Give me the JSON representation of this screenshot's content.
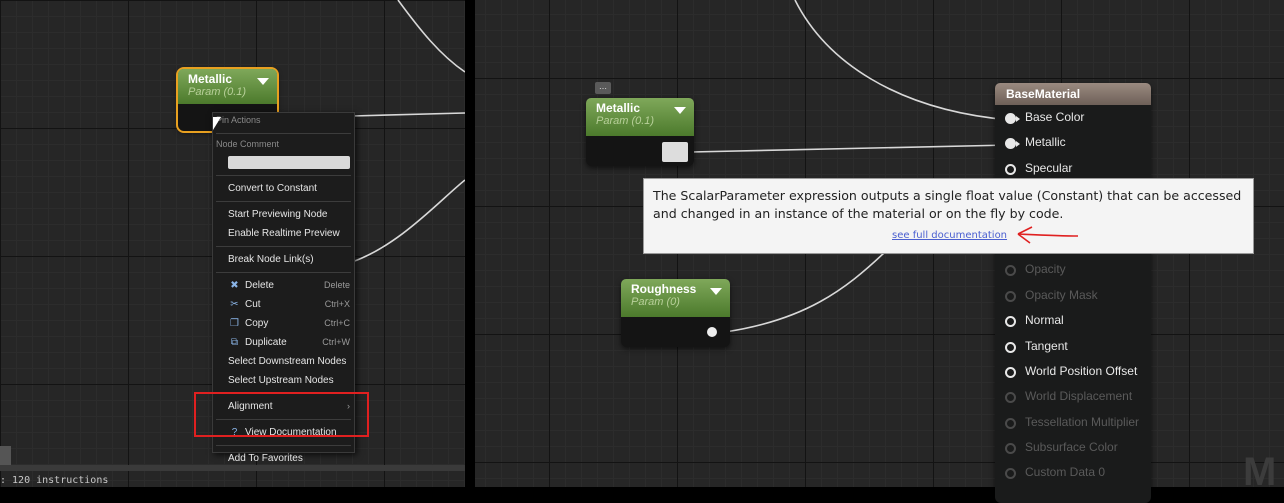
{
  "left_panel": {
    "metallic_node": {
      "title": "Metallic",
      "subtitle": "Param (0.1)"
    },
    "context_menu": {
      "pin_actions_header": "Pin Actions",
      "node_comment_header": "Node Comment",
      "items": [
        {
          "label": "Convert to Constant",
          "shortcut": "",
          "icon": ""
        },
        {
          "label": "Start Previewing Node",
          "shortcut": "",
          "icon": ""
        },
        {
          "label": "Enable Realtime Preview",
          "shortcut": "",
          "icon": ""
        },
        {
          "label": "Break Node Link(s)",
          "shortcut": "",
          "icon": ""
        },
        {
          "label": "Delete",
          "shortcut": "Delete",
          "icon": "delete-icon"
        },
        {
          "label": "Cut",
          "shortcut": "Ctrl+X",
          "icon": "cut-icon"
        },
        {
          "label": "Copy",
          "shortcut": "Ctrl+C",
          "icon": "copy-icon"
        },
        {
          "label": "Duplicate",
          "shortcut": "Ctrl+W",
          "icon": "duplicate-icon"
        },
        {
          "label": "Select Downstream Nodes",
          "shortcut": "",
          "icon": ""
        },
        {
          "label": "Select Upstream Nodes",
          "shortcut": "",
          "icon": ""
        },
        {
          "label": "Alignment",
          "shortcut": "",
          "icon": ""
        },
        {
          "label": "View Documentation",
          "shortcut": "",
          "icon": "help-icon"
        },
        {
          "label": "Add To Favorites",
          "shortcut": "",
          "icon": ""
        }
      ]
    },
    "status_text": ": 120 instructions"
  },
  "right_panel": {
    "metallic_node": {
      "title": "Metallic",
      "subtitle": "Param (0.1)"
    },
    "roughness_node": {
      "title": "Roughness",
      "subtitle": "Param (0)"
    },
    "base_material": {
      "title": "BaseMaterial",
      "pins": [
        {
          "label": "Base Color",
          "state": "connected"
        },
        {
          "label": "Metallic",
          "state": "connected"
        },
        {
          "label": "Specular",
          "state": "enabled"
        },
        {
          "label": "",
          "state": "hidden"
        },
        {
          "label": "",
          "state": "hidden"
        },
        {
          "label": "",
          "state": "disabled"
        },
        {
          "label": "Opacity",
          "state": "disabled"
        },
        {
          "label": "Opacity Mask",
          "state": "disabled"
        },
        {
          "label": "Normal",
          "state": "enabled"
        },
        {
          "label": "Tangent",
          "state": "enabled"
        },
        {
          "label": "World Position Offset",
          "state": "enabled"
        },
        {
          "label": "World Displacement",
          "state": "disabled"
        },
        {
          "label": "Tessellation Multiplier",
          "state": "disabled"
        },
        {
          "label": "Subsurface Color",
          "state": "disabled"
        },
        {
          "label": "Custom Data 0",
          "state": "disabled"
        }
      ]
    },
    "tooltip": {
      "text": "The ScalarParameter expression outputs a single float value (Constant) that can be accessed and changed in an instance of the material or on the fly by code.",
      "link": "see full documentation"
    },
    "watermark": "M"
  },
  "colors": {
    "param_header": "#5e8c3c",
    "material_header": "#8a7a70",
    "annotation_red": "#e02020",
    "link_blue": "#4a5fd0"
  }
}
